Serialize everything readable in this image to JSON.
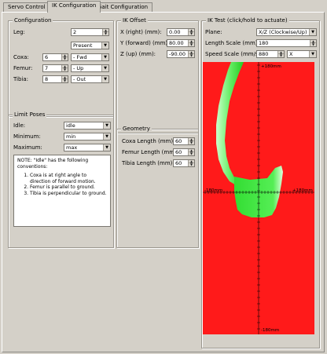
{
  "tabs": [
    {
      "label": "Servo Control"
    },
    {
      "label": "IK Configuration"
    },
    {
      "label": "Gait Configuration"
    }
  ],
  "configuration": {
    "title": "Configuration",
    "leg_label": "Leg:",
    "leg_value": "2",
    "preset_value": "Present",
    "coxa_label": "Coxa:",
    "coxa_value": "6",
    "coxa_dir": "- Fwd",
    "femur_label": "Femur:",
    "femur_value": "7",
    "femur_dir": "- Up",
    "tibia_label": "Tibia:",
    "tibia_value": "8",
    "tibia_dir": "- Out"
  },
  "limit_poses": {
    "title": "Limit Poses",
    "idle_label": "Idle:",
    "idle_value": "idle",
    "minimum_label": "Minimum:",
    "minimum_value": "min",
    "maximum_label": "Maximum:",
    "maximum_value": "max",
    "note_intro": "NOTE: \"Idle\" has the following conventions:",
    "note_items": [
      "Coxa is at right angle to direction of forward motion.",
      "Femur is parallel to ground.",
      "Tibia is perpendicular to ground."
    ]
  },
  "ik_offset": {
    "title": "IK Offset",
    "x_label": "X (right) (mm):",
    "x_value": "0.00",
    "y_label": "Y (forward) (mm):",
    "y_value": "80.00",
    "z_label": "Z (up) (mm):",
    "z_value": "-90.00"
  },
  "geometry": {
    "title": "Geometry",
    "coxa_label": "Coxa Length (mm):",
    "coxa_value": "60",
    "femur_label": "Femur Length (mm):",
    "femur_value": "60",
    "tibia_label": "Tibia Length (mm):",
    "tibia_value": "60"
  },
  "ik_test": {
    "title": "IK Test (click/hold to actuate)",
    "plane_label": "Plane:",
    "plane_value": "X/Z (Clockwise/Up)",
    "length_scale_label": "Length Scale (mm):",
    "length_scale_value": "180",
    "speed_scale_label": "Speed Scale (mm/s):",
    "speed_scale_value": "880",
    "axis_value": "X",
    "axis_top": "+180mm",
    "axis_bottom": "-180mm",
    "axis_left": "-180mm",
    "axis_right": "+180mm",
    "colors": {
      "unreachable": "#ff1a1a",
      "reachable": "#33dd33",
      "reachable_light": "#ccffcc"
    }
  },
  "icons": {
    "spin_up": "▲",
    "spin_down": "▼",
    "combo_arrow": "▼"
  }
}
